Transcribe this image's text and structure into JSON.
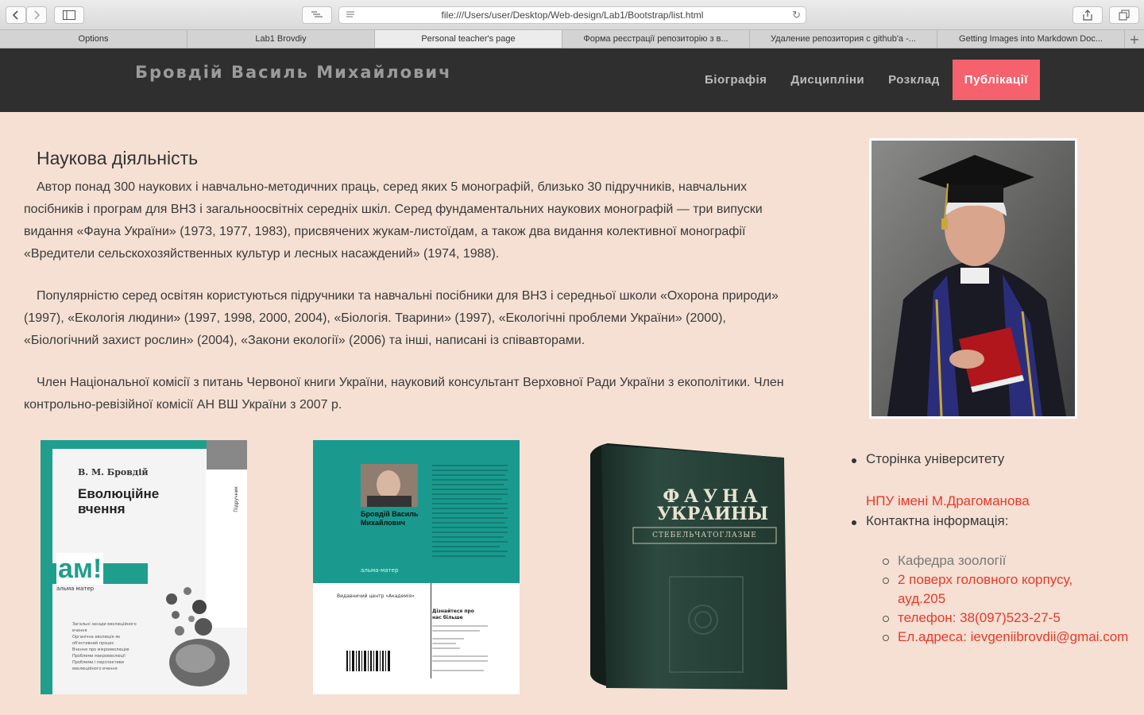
{
  "browser": {
    "url": "file:///Users/user/Desktop/Web-design/Lab1/Bootstrap/list.html",
    "tabs": [
      {
        "label": "Options",
        "active": false
      },
      {
        "label": "Lab1 Brovdiy",
        "active": false
      },
      {
        "label": "Personal teacher's page",
        "active": true
      },
      {
        "label": "Форма реєстрації репозиторію з в...",
        "active": false
      },
      {
        "label": "Удаление репозитория с github'a -...",
        "active": false
      },
      {
        "label": "Getting Images into Markdown Doc...",
        "active": false
      }
    ]
  },
  "header": {
    "brand": "Бровдій Василь Михайлович",
    "nav": [
      {
        "label": "Біографія",
        "active": false
      },
      {
        "label": "Дисципліни",
        "active": false
      },
      {
        "label": "Розклад",
        "active": false
      },
      {
        "label": "Публікації",
        "active": true
      }
    ]
  },
  "main": {
    "heading": "Наукова діяльність",
    "paragraphs": [
      "Автор понад 300 наукових і навчально-методичних праць, серед яких 5 монографій, близько 30 підручників, навчальних посібників і програм для ВНЗ і загальноосвітніх середніх шкіл. Серед фундаментальних наукових монографій — три випуски видання «Фауна України» (1973, 1977, 1983), присвячених жукам-листоїдам, а також два видання колективної монографії «Вредители сельскохозяйственных культур и лесных насаждений» (1974, 1988).",
      "Популярністю серед освітян користуються підручники та навчальні посібники для ВНЗ і середньої школи «Охорона природи» (1997), «Екологія людини» (1997, 1998, 2000, 2004), «Біологія. Тварини» (1997), «Екологічні проблеми України» (2000), «Біологічний захист рослин» (2004), «Закони екології» (2006) та інші, написані із співавторами.",
      "Член Національної комісії з питань Червоної книги України, науковий консультант Верховної Ради України з екополітики. Член контрольно-ревізійної комісії АН ВШ України з 2007 р."
    ]
  },
  "books": {
    "book1": {
      "author": "В. М. Бровдій",
      "title_line1": "Еволюційне",
      "title_line2": "вчення",
      "side": "Підручник",
      "logo": "ам!",
      "logo_sub": "альма матер",
      "toc": [
        "Загальні засади еволюційного вчення",
        "Органічна еволюція як об'єктивний процес",
        "Вчення про мікроеволюцію",
        "Проблеми макроеволюції",
        "Проблеми і перспективи еволюційного вчення"
      ]
    },
    "book2": {
      "author_name": "Бровдій Василь Михайлович",
      "series": "альма-матер",
      "publisher": "Видавничий центр «Академія»",
      "learn_more": "Дізнайтеся про нас більше"
    },
    "book3": {
      "title_line1": "ФАУНА",
      "title_line2": "УКРАИНЫ",
      "subtitle": "СТЕБЕЛЬЧАТОГЛАЗЫЕ"
    }
  },
  "sidebar": {
    "university_label": "Сторінка університету",
    "university_link": "НПУ імені М.Драгоманова",
    "contacts_label": "Контактна інформація:",
    "contacts": {
      "dept": "Кафедра зоології",
      "room_line1": "2 поверх головного корпусу,",
      "room_line2": "ауд.205",
      "phone": "телефон: 38(097)523-27-5",
      "email": "Ел.адреса: ievgeniibrovdii@gmai.com"
    }
  },
  "colors": {
    "page_bg": "#f5e0d3",
    "navbar_bg": "#2f2f2f",
    "accent": "#f5616d",
    "link": "#e8392b"
  }
}
